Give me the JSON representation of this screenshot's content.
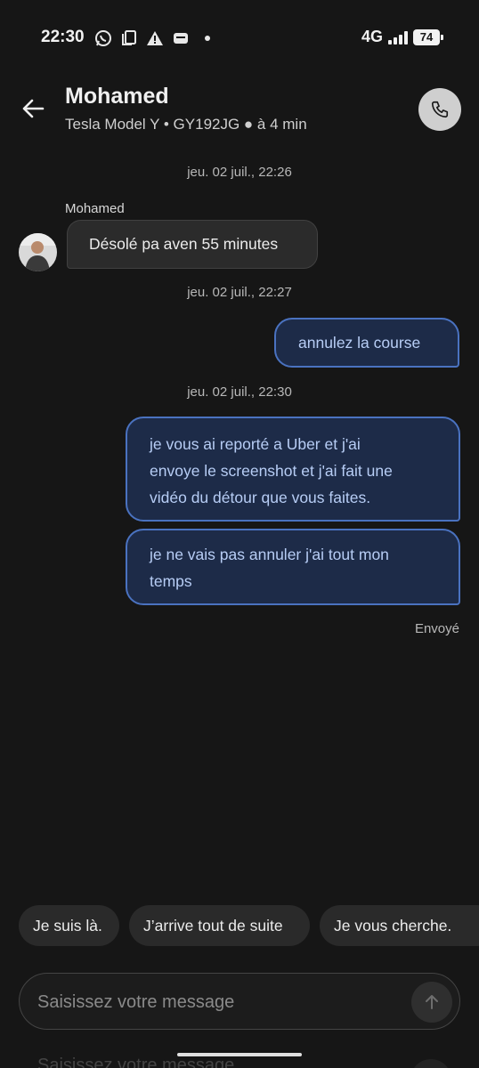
{
  "status_bar": {
    "time": "22:30",
    "icons": [
      "whatsapp-icon",
      "copy-icon",
      "warning-icon",
      "wallet-icon",
      "dot-icon"
    ],
    "network": "4G",
    "battery": "74"
  },
  "header": {
    "contact_name": "Mohamed",
    "subtitle": "Tesla Model Y • GY192JG ● à 4 min"
  },
  "messages": [
    {
      "type": "timestamp",
      "text": "jeu. 02 juil., 22:26"
    },
    {
      "type": "sender",
      "text": "Mohamed"
    },
    {
      "type": "incoming",
      "text": "Désolé pa aven 55 minutes"
    },
    {
      "type": "timestamp",
      "text": "jeu. 02 juil., 22:27"
    },
    {
      "type": "outgoing",
      "text": "annulez la course"
    },
    {
      "type": "timestamp",
      "text": "jeu. 02 juil., 22:30"
    },
    {
      "type": "outgoing",
      "lines": [
        "je vous ai reporté a Uber et j'ai",
        "envoye le screenshot et j'ai fait une",
        "vidéo du détour que vous faites."
      ]
    },
    {
      "type": "outgoing",
      "lines": [
        "je ne vais pas annuler j'ai tout mon",
        "temps"
      ]
    }
  ],
  "message_status": "Envoyé",
  "quick_replies": [
    "Je suis là.",
    "J’arrive tout de suite",
    "Je vous cherche."
  ],
  "composer": {
    "placeholder": "Saisissez votre message",
    "ghost_text": "Saisissez votre message"
  },
  "colors": {
    "background": "#161616",
    "incoming_bubble": "#2b2b2b",
    "outgoing_bubble": "#1d2b48",
    "outgoing_border": "#4a72c0",
    "outgoing_text": "#b7cdf5"
  }
}
